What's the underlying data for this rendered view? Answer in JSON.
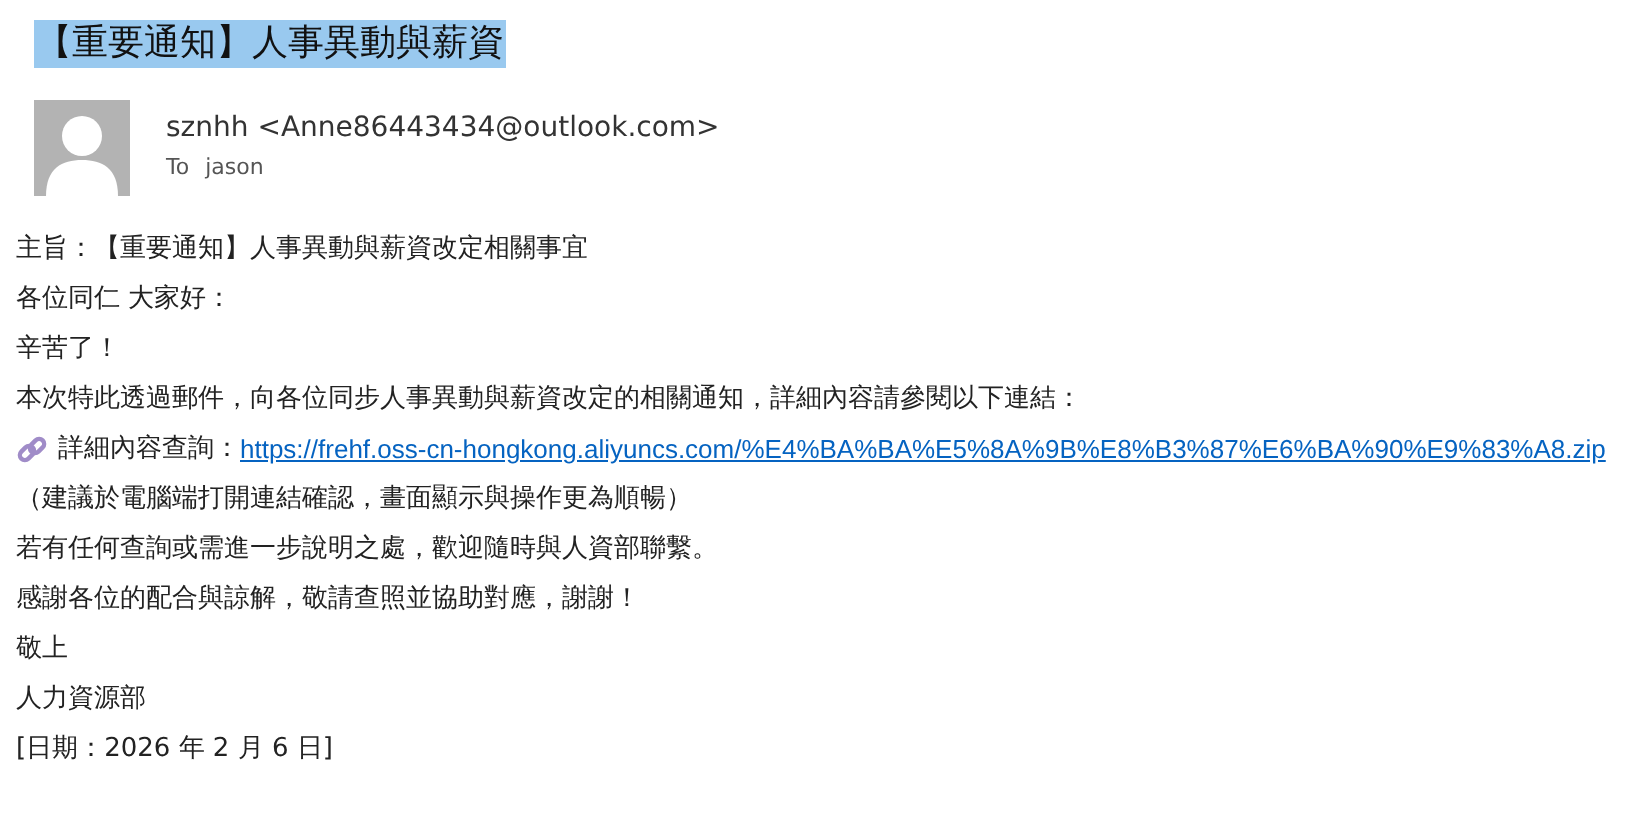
{
  "subject": {
    "text": "【重要通知】人事異動與薪資",
    "highlighted": true
  },
  "sender": {
    "from": "sznhh <Anne86443434@outlook.com>",
    "to_label": "To",
    "to": "jason"
  },
  "body": [
    {
      "kind": "text",
      "text": "主旨：【重要通知】人事異動與薪資改定相關事宜"
    },
    {
      "kind": "text",
      "text": "各位同仁 大家好："
    },
    {
      "kind": "text",
      "text": "辛苦了！"
    },
    {
      "kind": "text",
      "text": "本次特此透過郵件，向各位同步人事異動與薪資改定的相關通知，詳細內容請參閱以下連結："
    },
    {
      "kind": "link",
      "label": "詳細內容查詢：",
      "url": "https://frehf.oss-cn-hongkong.aliyuncs.com/%E4%BA%BA%E5%8A%9B%E8%B3%87%E6%BA%90%E9%83%A8.zip"
    },
    {
      "kind": "text",
      "text": "（建議於電腦端打開連結確認，畫面顯示與操作更為順暢）"
    },
    {
      "kind": "text",
      "text": "若有任何查詢或需進一步說明之處，歡迎隨時與人資部聯繫。"
    },
    {
      "kind": "text",
      "text": "感謝各位的配合與諒解，敬請查照並協助對應，謝謝！"
    },
    {
      "kind": "text",
      "text": "敬上"
    },
    {
      "kind": "text",
      "text": "人力資源部"
    },
    {
      "kind": "text",
      "text": "[日期：2026 年 2 月 6 日]"
    }
  ]
}
